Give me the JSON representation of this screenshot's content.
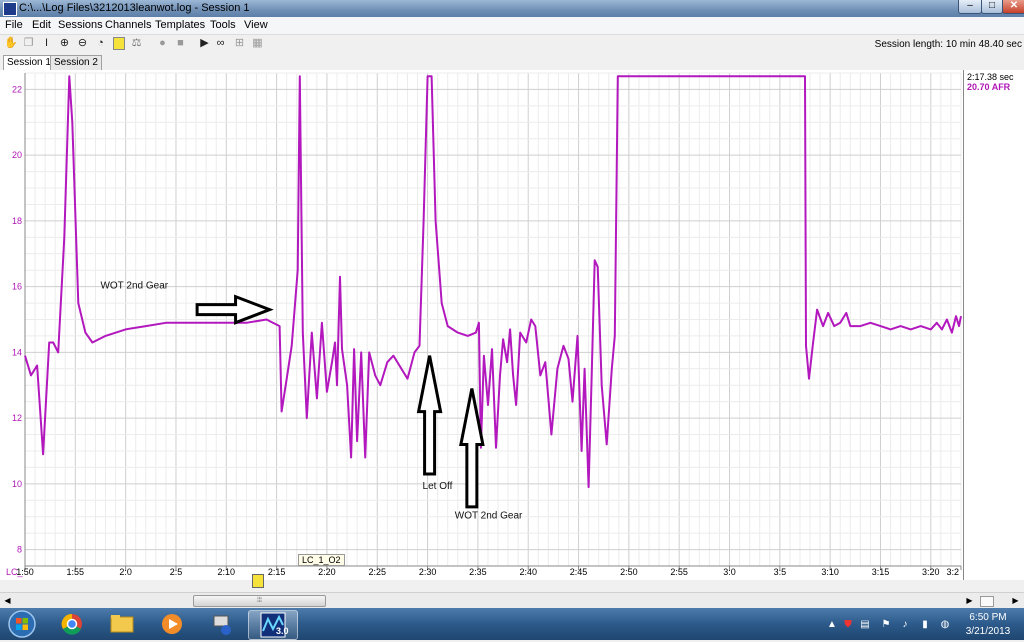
{
  "window": {
    "title": "C:\\...\\Log Files\\3212013leanwot.log - Session 1",
    "controls": {
      "minimize": "‒",
      "maximize": "□",
      "close": "✕"
    }
  },
  "menu": [
    "File",
    "Edit",
    "Sessions",
    "Channels",
    "Templates",
    "Tools",
    "View"
  ],
  "toolbar": {
    "icons": [
      "hand-icon",
      "copy-icon",
      "cursor-i-icon",
      "zoom-in-icon",
      "zoom-out-icon",
      "clock-icon",
      "note-icon",
      "ruler-icon",
      "record-icon",
      "stop-icon",
      "play-icon",
      "binoculars-icon",
      "grid-icon",
      "table-icon"
    ],
    "session_length": "Session length:  10 min 48.40 sec"
  },
  "tabs": [
    "Session 1",
    "Session 2"
  ],
  "side_panel": {
    "cursor_time": "2:17.38 sec",
    "cursor_value": "20.70 AFR"
  },
  "marker": {
    "label": "LC_1_O2",
    "row_label": "LC_"
  },
  "chart_data": {
    "type": "line",
    "series_color": "#b218bd",
    "ylim": [
      7.5,
      22.5
    ],
    "xlim": [
      110,
      203
    ],
    "yticks": [
      {
        "v": 8,
        "label": "8"
      },
      {
        "v": 10,
        "label": "10"
      },
      {
        "v": 12,
        "label": "12"
      },
      {
        "v": 14,
        "label": "14"
      },
      {
        "v": 16,
        "label": "16"
      },
      {
        "v": 18,
        "label": "18"
      },
      {
        "v": 20,
        "label": "20"
      },
      {
        "v": 22,
        "label": "22"
      }
    ],
    "xticks": [
      {
        "t": 110,
        "label": "1:50"
      },
      {
        "t": 115,
        "label": "1:55"
      },
      {
        "t": 120,
        "label": "2:0"
      },
      {
        "t": 125,
        "label": "2:5"
      },
      {
        "t": 130,
        "label": "2:10"
      },
      {
        "t": 135,
        "label": "2:15"
      },
      {
        "t": 140,
        "label": "2:20"
      },
      {
        "t": 145,
        "label": "2:25"
      },
      {
        "t": 150,
        "label": "2:30"
      },
      {
        "t": 155,
        "label": "2:35"
      },
      {
        "t": 160,
        "label": "2:40"
      },
      {
        "t": 165,
        "label": "2:45"
      },
      {
        "t": 170,
        "label": "2:50"
      },
      {
        "t": 175,
        "label": "2:55"
      },
      {
        "t": 180,
        "label": "3:0"
      },
      {
        "t": 185,
        "label": "3:5"
      },
      {
        "t": 190,
        "label": "3:10"
      },
      {
        "t": 195,
        "label": "3:15"
      },
      {
        "t": 200,
        "label": "3:20"
      },
      {
        "t": 203,
        "label": "3:2"
      }
    ],
    "points": [
      [
        110,
        13.9
      ],
      [
        110.6,
        13.3
      ],
      [
        111.2,
        13.6
      ],
      [
        111.8,
        10.9
      ],
      [
        112.4,
        14.3
      ],
      [
        112.8,
        14.3
      ],
      [
        113.3,
        14.0
      ],
      [
        113.9,
        17.5
      ],
      [
        114.4,
        22.4
      ],
      [
        114.7,
        21.0
      ],
      [
        115.3,
        15.5
      ],
      [
        116,
        14.6
      ],
      [
        116.7,
        14.3
      ],
      [
        118,
        14.5
      ],
      [
        120,
        14.7
      ],
      [
        122,
        14.8
      ],
      [
        124,
        14.9
      ],
      [
        126,
        14.9
      ],
      [
        128,
        14.9
      ],
      [
        130,
        14.9
      ],
      [
        132,
        14.9
      ],
      [
        134,
        15.0
      ],
      [
        135.3,
        14.8
      ],
      [
        135.5,
        12.2
      ],
      [
        136,
        13.2
      ],
      [
        136.5,
        14.2
      ],
      [
        137.1,
        16.5
      ],
      [
        137.3,
        22.4
      ],
      [
        137.6,
        14.6
      ],
      [
        138,
        12.0
      ],
      [
        138.5,
        14.6
      ],
      [
        139,
        12.6
      ],
      [
        139.5,
        14.9
      ],
      [
        140,
        12.8
      ],
      [
        140.5,
        13.7
      ],
      [
        140.8,
        14.3
      ],
      [
        141,
        13.0
      ],
      [
        141.3,
        16.3
      ],
      [
        141.5,
        14.1
      ],
      [
        142,
        13.0
      ],
      [
        142.4,
        10.8
      ],
      [
        142.7,
        14.1
      ],
      [
        143,
        11.3
      ],
      [
        143.4,
        14.0
      ],
      [
        143.8,
        10.8
      ],
      [
        144.2,
        14.0
      ],
      [
        144.8,
        13.3
      ],
      [
        145.3,
        13.0
      ],
      [
        146,
        13.7
      ],
      [
        146.6,
        13.9
      ],
      [
        147.2,
        13.6
      ],
      [
        148,
        13.2
      ],
      [
        148.7,
        14.0
      ],
      [
        149.2,
        14.2
      ],
      [
        149.6,
        18.0
      ],
      [
        150,
        22.4
      ],
      [
        150.4,
        22.4
      ],
      [
        150.8,
        18.0
      ],
      [
        151.4,
        15.5
      ],
      [
        152,
        14.8
      ],
      [
        153,
        14.6
      ],
      [
        154,
        14.5
      ],
      [
        154.8,
        14.6
      ],
      [
        155.1,
        14.9
      ],
      [
        155.3,
        11.1
      ],
      [
        155.6,
        13.9
      ],
      [
        156,
        12.4
      ],
      [
        156.4,
        14.1
      ],
      [
        156.8,
        11.1
      ],
      [
        157.2,
        13.3
      ],
      [
        157.5,
        14.4
      ],
      [
        157.9,
        13.7
      ],
      [
        158.2,
        14.7
      ],
      [
        158.5,
        13.3
      ],
      [
        158.8,
        12.4
      ],
      [
        159.2,
        14.6
      ],
      [
        159.8,
        14.3
      ],
      [
        160.3,
        15.0
      ],
      [
        160.7,
        14.8
      ],
      [
        161.2,
        13.3
      ],
      [
        161.7,
        13.7
      ],
      [
        162.3,
        11.5
      ],
      [
        162.9,
        13.5
      ],
      [
        163.5,
        14.2
      ],
      [
        164,
        13.8
      ],
      [
        164.4,
        12.5
      ],
      [
        164.9,
        14.5
      ],
      [
        165.3,
        11.0
      ],
      [
        165.6,
        13.5
      ],
      [
        166,
        9.9
      ],
      [
        166.3,
        13.2
      ],
      [
        166.6,
        16.8
      ],
      [
        166.9,
        16.6
      ],
      [
        167.3,
        13.0
      ],
      [
        167.8,
        11.2
      ],
      [
        168.3,
        13.5
      ],
      [
        168.6,
        14.5
      ],
      [
        168.9,
        22.4
      ],
      [
        187.5,
        22.4
      ],
      [
        187.6,
        14.2
      ],
      [
        187.9,
        13.2
      ],
      [
        188.3,
        14.3
      ],
      [
        188.7,
        15.3
      ],
      [
        189.3,
        14.8
      ],
      [
        189.8,
        15.2
      ],
      [
        190.4,
        14.8
      ],
      [
        191,
        14.9
      ],
      [
        191.6,
        15.2
      ],
      [
        192,
        14.8
      ],
      [
        193,
        14.8
      ],
      [
        194,
        14.9
      ],
      [
        195,
        14.8
      ],
      [
        196,
        14.7
      ],
      [
        197,
        14.8
      ],
      [
        198,
        14.7
      ],
      [
        199,
        14.8
      ],
      [
        200,
        14.7
      ],
      [
        200.6,
        14.9
      ],
      [
        201.1,
        14.7
      ],
      [
        201.6,
        15.0
      ],
      [
        202.1,
        14.6
      ],
      [
        202.5,
        15.1
      ],
      [
        202.8,
        14.8
      ],
      [
        203,
        15.1
      ]
    ],
    "annotations": [
      {
        "text": "WOT 2nd Gear",
        "at": [
          117.5,
          15.95
        ],
        "arrow_dir": "right",
        "arrow_from": [
          127.1,
          15.3
        ],
        "arrow_to": [
          134.3,
          15.3
        ]
      },
      {
        "text": "Let Off",
        "at": [
          149.5,
          9.85
        ],
        "arrow_dir": "up",
        "arrow_from": [
          150.2,
          10.3
        ],
        "arrow_to": [
          150.2,
          13.9
        ]
      },
      {
        "text": "WOT 2nd Gear",
        "at": [
          152.7,
          8.95
        ],
        "arrow_dir": "up",
        "arrow_from": [
          154.4,
          9.3
        ],
        "arrow_to": [
          154.4,
          12.9
        ]
      }
    ]
  },
  "taskbar": {
    "apps": [
      "start-orb-icon",
      "chrome-icon",
      "file-explorer-icon",
      "media-player-icon",
      "network-app-icon",
      "logworks-icon"
    ],
    "active_app_label": "3.0",
    "tray": [
      "chevron-up-icon",
      "shield-icon",
      "folder-sync-icon",
      "flag-icon",
      "speaker-icon",
      "network-icon",
      "globe-icon"
    ],
    "clock_time": "6:50 PM",
    "clock_date": "3/21/2013"
  }
}
